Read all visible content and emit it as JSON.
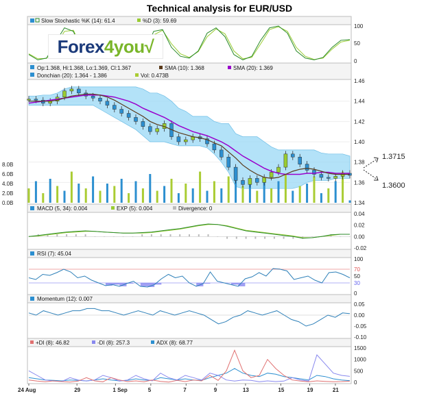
{
  "title": "Technical analysis for EUR/USD",
  "logo": {
    "part1": "Forex",
    "part2": "4you",
    "mark": "√"
  },
  "panels": {
    "stoch": {
      "legend": [
        "Slow Stochastic %K (14): 61.4",
        "%D (3): 59.69"
      ],
      "ticks": [
        "100",
        "50",
        "0"
      ],
      "colors": [
        "#2a8a2a",
        "#99cc33"
      ]
    },
    "price": {
      "legend_line1": [
        "Op:1.368, Hi:1.368, Lo:1.369, Cl:1.367",
        "SMA (10): 1.368",
        "SMA (20): 1.369"
      ],
      "legend_line2": [
        "Donchian (20): 1.364 - 1.386",
        "Vol: 0.473B"
      ],
      "ticks": [
        "1.46",
        "1.44",
        "1.42",
        "1.40",
        "1.38",
        "1.36",
        "1.34"
      ],
      "vol_ticks": [
        "8.0B",
        "6.0B",
        "4.0B",
        "2.0B",
        "0.0B"
      ],
      "colors": {
        "sma10": "#5a3a1a",
        "sma20": "#9900cc",
        "donchian": "#9ad8f5",
        "vol": "#aacc33"
      }
    },
    "macd": {
      "legend": [
        "MACD (5, 34): 0.004",
        "EXP (5): 0.004",
        "Divergence: 0"
      ],
      "ticks": [
        "0.04",
        "0.02",
        "0.00",
        "-0.02"
      ],
      "colors": [
        "#2a8a2a",
        "#99cc33",
        "#bbbbbb"
      ]
    },
    "rsi": {
      "legend": [
        "RSI (7): 45.04"
      ],
      "ticks": [
        "100",
        "70",
        "50",
        "30",
        "0"
      ],
      "colors": {
        "line": "#2c7fb8",
        "upper": "#e05050",
        "lower": "#6666ee"
      }
    },
    "momentum": {
      "legend": [
        "Momentum (12): 0.007"
      ],
      "ticks": [
        "0.05",
        "0.00",
        "-0.05",
        "-0.10"
      ],
      "colors": {
        "line": "#2c7fb8"
      }
    },
    "adx": {
      "legend": [
        "+DI (8): 46.82",
        "-DI (8): 257.3",
        "ADX (8): 68.77"
      ],
      "ticks": [
        "1500",
        "1000",
        "500",
        "0"
      ],
      "colors": [
        "#e07070",
        "#8888ee",
        "#2c8fd0"
      ]
    }
  },
  "x_axis": [
    "24 Aug",
    "29",
    "1 Sep",
    "5",
    "7",
    "9",
    "13",
    "15",
    "19",
    "21"
  ],
  "annotations": {
    "upper": "1.3715",
    "lower": "1.3600"
  },
  "chart_data": [
    {
      "type": "line",
      "title": "Slow Stochastic",
      "series": [
        {
          "name": "Slow Stochastic %K (14)",
          "values": [
            20,
            5,
            10,
            55,
            95,
            85,
            25,
            10,
            12,
            60,
            70,
            60,
            10,
            25,
            85,
            90,
            40,
            15,
            10,
            30,
            80,
            95,
            70,
            20,
            5,
            15,
            60,
            95,
            100,
            80,
            30,
            10,
            5,
            12,
            40,
            60,
            62
          ]
        },
        {
          "name": "%D (3)",
          "values": [
            22,
            8,
            9,
            45,
            85,
            88,
            35,
            15,
            12,
            50,
            68,
            62,
            18,
            22,
            75,
            88,
            50,
            22,
            12,
            28,
            70,
            92,
            78,
            30,
            8,
            12,
            50,
            90,
            98,
            85,
            40,
            15,
            6,
            10,
            35,
            55,
            60
          ]
        }
      ],
      "ylim": [
        0,
        100
      ]
    },
    {
      "type": "candlestick",
      "title": "EUR/USD price",
      "series": [
        {
          "name": "Close",
          "values": [
            1.442,
            1.441,
            1.438,
            1.44,
            1.444,
            1.45,
            1.452,
            1.448,
            1.445,
            1.443,
            1.44,
            1.436,
            1.432,
            1.428,
            1.424,
            1.42,
            1.415,
            1.41,
            1.413,
            1.418,
            1.405,
            1.4,
            1.402,
            1.405,
            1.403,
            1.398,
            1.392,
            1.385,
            1.375,
            1.362,
            1.358,
            1.364,
            1.36,
            1.365,
            1.37,
            1.375,
            1.388,
            1.385,
            1.378,
            1.372,
            1.368,
            1.365,
            1.364,
            1.366,
            1.369,
            1.367
          ]
        },
        {
          "name": "SMA (10)",
          "values": [
            1.44,
            1.44,
            1.44,
            1.44,
            1.441,
            1.443,
            1.445,
            1.446,
            1.447,
            1.447,
            1.446,
            1.444,
            1.441,
            1.437,
            1.433,
            1.429,
            1.425,
            1.42,
            1.417,
            1.415,
            1.412,
            1.409,
            1.407,
            1.405,
            1.404,
            1.402,
            1.399,
            1.396,
            1.39,
            1.384,
            1.377,
            1.372,
            1.368,
            1.365,
            1.364,
            1.365,
            1.368,
            1.371,
            1.373,
            1.374,
            1.373,
            1.371,
            1.369,
            1.368,
            1.368,
            1.368
          ]
        },
        {
          "name": "SMA (20)",
          "values": [
            1.438,
            1.439,
            1.44,
            1.441,
            1.442,
            1.443,
            1.444,
            1.445,
            1.446,
            1.446,
            1.446,
            1.445,
            1.444,
            1.442,
            1.44,
            1.437,
            1.433,
            1.43,
            1.427,
            1.424,
            1.42,
            1.416,
            1.413,
            1.41,
            1.408,
            1.406,
            1.403,
            1.4,
            1.396,
            1.391,
            1.386,
            1.382,
            1.378,
            1.374,
            1.371,
            1.369,
            1.368,
            1.368,
            1.368,
            1.369,
            1.369,
            1.37,
            1.37,
            1.369,
            1.369,
            1.369
          ]
        },
        {
          "name": "Donchian upper",
          "values": [
            1.445,
            1.445,
            1.446,
            1.446,
            1.448,
            1.452,
            1.454,
            1.454,
            1.454,
            1.454,
            1.454,
            1.454,
            1.454,
            1.454,
            1.454,
            1.454,
            1.452,
            1.448,
            1.448,
            1.445,
            1.44,
            1.433,
            1.43,
            1.425,
            1.425,
            1.425,
            1.42,
            1.418,
            1.418,
            1.408,
            1.405,
            1.405,
            1.405,
            1.4,
            1.395,
            1.392,
            1.392,
            1.392,
            1.392,
            1.392,
            1.392,
            1.389,
            1.388,
            1.388,
            1.388,
            1.386
          ]
        },
        {
          "name": "Donchian lower",
          "values": [
            1.436,
            1.436,
            1.436,
            1.436,
            1.436,
            1.436,
            1.436,
            1.436,
            1.436,
            1.436,
            1.432,
            1.428,
            1.424,
            1.42,
            1.416,
            1.412,
            1.406,
            1.4,
            1.4,
            1.4,
            1.398,
            1.396,
            1.396,
            1.396,
            1.396,
            1.394,
            1.388,
            1.38,
            1.37,
            1.356,
            1.354,
            1.354,
            1.354,
            1.354,
            1.354,
            1.354,
            1.354,
            1.354,
            1.356,
            1.36,
            1.362,
            1.362,
            1.362,
            1.364,
            1.364,
            1.364
          ]
        },
        {
          "name": "Vol",
          "values": [
            3.0,
            4.5,
            2.0,
            5.0,
            3.5,
            2.5,
            6.5,
            4.0,
            3.0,
            5.5,
            2.5,
            4.0,
            3.5,
            5.0,
            2.0,
            4.5,
            3.0,
            6.0,
            2.5,
            3.5,
            5.0,
            2.0,
            4.0,
            3.0,
            6.5,
            2.5,
            4.5,
            3.0,
            5.5,
            7.0,
            3.5,
            4.0,
            2.5,
            5.0,
            3.0,
            4.5,
            6.0,
            2.5,
            3.5,
            4.0,
            5.5,
            2.0,
            3.0,
            4.5,
            6.5,
            0.5
          ]
        }
      ],
      "ylim": [
        1.34,
        1.46
      ]
    },
    {
      "type": "line",
      "title": "MACD",
      "series": [
        {
          "name": "MACD (5, 34)",
          "values": [
            0.0,
            0.002,
            0.004,
            0.006,
            0.008,
            0.009,
            0.01,
            0.009,
            0.008,
            0.007,
            0.006,
            0.006,
            0.007,
            0.008,
            0.01,
            0.012,
            0.014,
            0.017,
            0.02,
            0.022,
            0.021,
            0.018,
            0.014,
            0.01,
            0.008,
            0.006,
            0.004,
            0.002,
            0.0,
            -0.003,
            -0.002,
            0.0,
            0.003,
            0.004,
            0.004
          ]
        },
        {
          "name": "EXP (5)",
          "values": [
            0.0,
            0.001,
            0.003,
            0.005,
            0.007,
            0.008,
            0.009,
            0.009,
            0.008,
            0.007,
            0.006,
            0.006,
            0.006,
            0.007,
            0.009,
            0.011,
            0.013,
            0.016,
            0.019,
            0.021,
            0.021,
            0.019,
            0.015,
            0.011,
            0.009,
            0.007,
            0.005,
            0.003,
            0.001,
            -0.002,
            -0.002,
            0.0,
            0.002,
            0.004,
            0.004
          ]
        }
      ],
      "ylim": [
        -0.02,
        0.04
      ]
    },
    {
      "type": "line",
      "title": "RSI",
      "series": [
        {
          "name": "RSI (7)",
          "values": [
            45,
            40,
            55,
            52,
            60,
            70,
            62,
            45,
            50,
            38,
            30,
            22,
            25,
            20,
            28,
            35,
            20,
            18,
            25,
            42,
            55,
            45,
            50,
            30,
            20,
            28,
            62,
            35,
            30,
            25,
            20,
            42,
            48,
            60,
            50,
            72,
            70,
            65,
            40,
            45,
            50,
            38,
            30,
            60,
            62,
            55,
            45
          ]
        }
      ],
      "ylim": [
        0,
        100
      ]
    },
    {
      "type": "line",
      "title": "Momentum",
      "series": [
        {
          "name": "Momentum (12)",
          "values": [
            0.01,
            0.0,
            0.02,
            0.01,
            0.0,
            0.01,
            0.02,
            0.02,
            0.03,
            0.03,
            0.02,
            0.02,
            0.01,
            0.0,
            0.01,
            0.02,
            0.01,
            0.0,
            0.02,
            0.01,
            0.0,
            0.01,
            0.02,
            0.01,
            0.0,
            -0.02,
            -0.04,
            -0.03,
            -0.01,
            0.0,
            0.02,
            0.01,
            0.0,
            0.01,
            0.02,
            0.0,
            -0.02,
            -0.03,
            -0.05,
            -0.04,
            -0.02,
            0.0,
            -0.01,
            0.01,
            0.007
          ]
        }
      ],
      "ylim": [
        -0.1,
        0.05
      ]
    },
    {
      "type": "line",
      "title": "ADX",
      "series": [
        {
          "name": "+DI (8)",
          "values": [
            100,
            50,
            20,
            60,
            30,
            10,
            50,
            200,
            60,
            20,
            200,
            100,
            30,
            60,
            20,
            100,
            40,
            10,
            80,
            30,
            100,
            60,
            300,
            80,
            500,
            1400,
            500,
            200,
            300,
            1000,
            600,
            300,
            100,
            50,
            20,
            60,
            40,
            20,
            30,
            46.82
          ]
        },
        {
          "name": "-DI (8)",
          "values": [
            500,
            300,
            100,
            50,
            30,
            200,
            100,
            50,
            100,
            300,
            200,
            50,
            100,
            300,
            150,
            60,
            400,
            200,
            100,
            300,
            200,
            100,
            400,
            300,
            100,
            50,
            100,
            80,
            20,
            60,
            30,
            50,
            200,
            100,
            50,
            1200,
            800,
            400,
            300,
            257.3
          ]
        },
        {
          "name": "ADX (8)",
          "values": [
            200,
            150,
            100,
            80,
            60,
            100,
            80,
            60,
            100,
            150,
            100,
            60,
            80,
            150,
            100,
            80,
            200,
            150,
            100,
            150,
            100,
            80,
            200,
            300,
            400,
            600,
            400,
            300,
            250,
            400,
            350,
            250,
            200,
            150,
            100,
            300,
            250,
            150,
            100,
            68.77
          ]
        }
      ],
      "ylim": [
        0,
        1500
      ]
    }
  ]
}
